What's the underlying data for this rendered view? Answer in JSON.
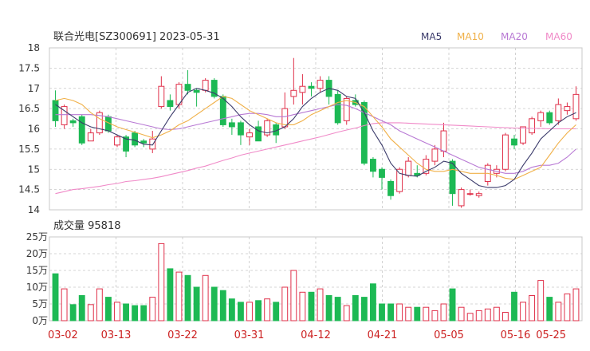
{
  "colors": {
    "up": "#e0304a",
    "down": "#1db954",
    "ma5": "#3a3a6a",
    "ma10": "#f0b048",
    "ma20": "#b879d4",
    "ma60": "#f08ac8",
    "grid": "#c8c8c8",
    "axis_text": "#333333",
    "date_text": "#cc2222"
  },
  "chart_data": [
    {
      "type": "candlestick",
      "title": "联合光电[SZ300691] 2023-05-31",
      "legend": [
        "MA5",
        "MA10",
        "MA20",
        "MA60"
      ],
      "legend_position": "top-right",
      "ylim": [
        14,
        18
      ],
      "yticks": [
        "18",
        "17.5",
        "17",
        "16.5",
        "16",
        "15.5",
        "15",
        "14.5",
        "14"
      ],
      "x_dates": [
        "03-02",
        "03-13",
        "03-22",
        "03-31",
        "04-12",
        "04-21",
        "05-05",
        "05-16",
        "05-25"
      ],
      "candles": [
        [
          16.7,
          16.2,
          16.95,
          16.05
        ],
        [
          16.1,
          16.55,
          16.6,
          16.0
        ],
        [
          16.2,
          16.15,
          16.25,
          16.05
        ],
        [
          16.3,
          15.65,
          16.35,
          15.6
        ],
        [
          15.7,
          15.9,
          16.0,
          15.7
        ],
        [
          15.9,
          16.4,
          16.45,
          15.85
        ],
        [
          16.3,
          15.95,
          16.35,
          15.9
        ],
        [
          15.6,
          15.8,
          15.85,
          15.55
        ],
        [
          15.8,
          15.45,
          15.85,
          15.3
        ],
        [
          15.9,
          15.6,
          15.95,
          15.55
        ],
        [
          15.7,
          15.65,
          15.75,
          15.55
        ],
        [
          15.5,
          15.75,
          15.95,
          15.4
        ],
        [
          16.55,
          17.05,
          17.3,
          16.5
        ],
        [
          16.7,
          16.55,
          16.85,
          16.45
        ],
        [
          16.6,
          17.1,
          17.15,
          16.5
        ],
        [
          17.1,
          16.95,
          17.45,
          16.85
        ],
        [
          16.95,
          16.9,
          17.0,
          16.55
        ],
        [
          16.95,
          17.2,
          17.25,
          16.9
        ],
        [
          17.2,
          16.8,
          17.25,
          16.75
        ],
        [
          16.8,
          16.1,
          16.85,
          16.05
        ],
        [
          16.15,
          16.05,
          16.25,
          15.85
        ],
        [
          16.15,
          15.85,
          16.2,
          15.6
        ],
        [
          15.8,
          15.9,
          16.0,
          15.6
        ],
        [
          16.05,
          15.7,
          16.2,
          15.7
        ],
        [
          15.85,
          16.2,
          16.25,
          15.8
        ],
        [
          16.1,
          15.85,
          16.15,
          15.65
        ],
        [
          16.05,
          16.5,
          16.9,
          16.0
        ],
        [
          16.8,
          16.95,
          17.75,
          16.6
        ],
        [
          16.9,
          17.05,
          17.35,
          16.6
        ],
        [
          17.05,
          17.0,
          17.15,
          16.8
        ],
        [
          17.0,
          17.2,
          17.3,
          16.9
        ],
        [
          17.2,
          16.8,
          17.3,
          16.6
        ],
        [
          16.85,
          16.15,
          16.95,
          16.1
        ],
        [
          16.2,
          16.75,
          16.8,
          16.1
        ],
        [
          16.7,
          16.6,
          16.85,
          16.55
        ],
        [
          16.65,
          15.15,
          16.7,
          15.1
        ],
        [
          15.25,
          14.95,
          15.3,
          14.8
        ],
        [
          15.0,
          14.8,
          15.05,
          14.5
        ],
        [
          14.7,
          14.35,
          14.75,
          14.25
        ],
        [
          14.45,
          15.0,
          15.05,
          14.4
        ],
        [
          14.85,
          15.2,
          15.3,
          14.8
        ],
        [
          14.9,
          14.85,
          15.1,
          14.8
        ],
        [
          14.9,
          15.25,
          15.35,
          14.85
        ],
        [
          15.2,
          15.5,
          15.6,
          15.1
        ],
        [
          15.45,
          15.95,
          16.15,
          15.3
        ],
        [
          15.2,
          14.4,
          15.25,
          14.1
        ],
        [
          14.1,
          14.5,
          14.55,
          14.05
        ],
        [
          14.4,
          14.4,
          14.5,
          14.35
        ],
        [
          14.35,
          14.4,
          14.45,
          14.3
        ],
        [
          14.7,
          15.1,
          15.15,
          14.6
        ],
        [
          14.9,
          15.0,
          15.1,
          14.8
        ],
        [
          15.0,
          15.85,
          15.9,
          14.95
        ],
        [
          15.75,
          15.6,
          15.85,
          15.5
        ],
        [
          15.65,
          16.05,
          16.05,
          15.6
        ],
        [
          15.9,
          16.25,
          16.3,
          15.85
        ],
        [
          16.2,
          16.4,
          16.45,
          16.05
        ],
        [
          16.4,
          16.15,
          16.45,
          16.1
        ],
        [
          16.2,
          16.6,
          16.75,
          16.1
        ],
        [
          16.45,
          16.55,
          16.65,
          16.35
        ],
        [
          16.25,
          16.85,
          17.05,
          16.2
        ]
      ],
      "ma5": [
        16.6,
        16.45,
        16.3,
        16.15,
        16.05,
        16.0,
        15.95,
        15.85,
        15.75,
        15.72,
        15.62,
        15.6,
        15.95,
        16.3,
        16.6,
        16.9,
        17.0,
        16.95,
        16.88,
        16.75,
        16.55,
        16.3,
        16.1,
        15.95,
        15.9,
        15.95,
        16.05,
        16.25,
        16.55,
        16.75,
        16.9,
        17.0,
        16.95,
        16.8,
        16.75,
        16.4,
        15.95,
        15.6,
        15.15,
        14.9,
        14.85,
        14.83,
        14.95,
        15.05,
        15.2,
        15.15,
        14.9,
        14.75,
        14.6,
        14.55,
        14.55,
        14.6,
        14.75,
        15.1,
        15.4,
        15.75,
        15.95,
        16.15,
        16.3,
        16.4
      ],
      "ma10": [
        16.7,
        16.75,
        16.7,
        16.6,
        16.4,
        16.25,
        16.15,
        16.05,
        15.98,
        15.92,
        15.85,
        15.78,
        15.85,
        15.95,
        16.1,
        16.2,
        16.35,
        16.5,
        16.65,
        16.8,
        16.75,
        16.6,
        16.45,
        16.35,
        16.25,
        16.15,
        16.1,
        16.1,
        16.2,
        16.35,
        16.45,
        16.55,
        16.65,
        16.7,
        16.65,
        16.55,
        16.3,
        16.05,
        15.75,
        15.55,
        15.35,
        15.15,
        15.0,
        14.95,
        14.95,
        15.0,
        14.95,
        14.9,
        14.9,
        14.9,
        14.85,
        14.78,
        14.75,
        14.85,
        14.95,
        15.05,
        15.35,
        15.65,
        15.9,
        16.1
      ],
      "ma20": [
        16.35,
        16.35,
        16.35,
        16.35,
        16.35,
        16.33,
        16.3,
        16.25,
        16.2,
        16.15,
        16.1,
        16.05,
        16.0,
        15.98,
        16.0,
        16.05,
        16.1,
        16.15,
        16.2,
        16.25,
        16.3,
        16.35,
        16.38,
        16.38,
        16.35,
        16.3,
        16.3,
        16.35,
        16.4,
        16.45,
        16.5,
        16.55,
        16.6,
        16.58,
        16.5,
        16.4,
        16.3,
        16.2,
        16.1,
        15.95,
        15.85,
        15.75,
        15.65,
        15.55,
        15.45,
        15.35,
        15.25,
        15.15,
        15.05,
        15.0,
        14.95,
        14.9,
        14.9,
        14.95,
        15.05,
        15.1,
        15.1,
        15.15,
        15.3,
        15.5
      ],
      "ma60": [
        14.4,
        14.45,
        14.5,
        14.52,
        14.55,
        14.58,
        14.62,
        14.65,
        14.7,
        14.72,
        14.75,
        14.78,
        14.82,
        14.87,
        14.92,
        14.97,
        15.03,
        15.08,
        15.15,
        15.22,
        15.28,
        15.35,
        15.4,
        15.45,
        15.5,
        15.55,
        15.6,
        15.65,
        15.7,
        15.75,
        15.8,
        15.86,
        15.92,
        15.97,
        16.02,
        16.08,
        16.13,
        16.15,
        16.15,
        16.15,
        16.14,
        16.13,
        16.12,
        16.11,
        16.1,
        16.09,
        16.08,
        16.07,
        16.06,
        16.05,
        16.04,
        16.03,
        16.02,
        16.02,
        16.01,
        16.01,
        16.0,
        16.0,
        16.0,
        16.0
      ]
    },
    {
      "type": "bar",
      "title": "成交量 95818",
      "ylim": [
        0,
        25
      ],
      "yticks": [
        "25万",
        "20万",
        "15万",
        "10万",
        "5万",
        "0万"
      ],
      "volumes": [
        14,
        9.5,
        4.8,
        7.5,
        4.8,
        9.5,
        7,
        5.5,
        5,
        4.5,
        4.5,
        7,
        23,
        15.5,
        14.5,
        13.5,
        10,
        13.5,
        10,
        9,
        6.5,
        5.5,
        5.5,
        6,
        6.5,
        5.5,
        10,
        15,
        8.5,
        8.5,
        9.5,
        7.5,
        7,
        4.5,
        7.5,
        7,
        11,
        5,
        5,
        5,
        4,
        4,
        4,
        3,
        5,
        9.5,
        4,
        2.2,
        3,
        3.5,
        4,
        2.5,
        8.5,
        5.5,
        7.5,
        12,
        7,
        5.5,
        8,
        9.5
      ]
    }
  ]
}
